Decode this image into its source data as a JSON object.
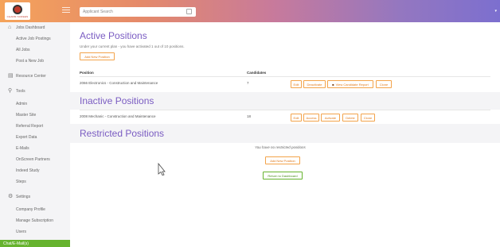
{
  "header": {
    "logo_text": "CHARM SCREEN",
    "search_placeholder": "Applicant Search"
  },
  "sidebar": {
    "items": [
      {
        "label": "Jobs Dashboard",
        "icon": "home-icon",
        "caret": true
      },
      {
        "label": "Active Job Postings"
      },
      {
        "label": "All Jobs"
      },
      {
        "label": "Post a New Job"
      },
      {
        "label": "Resource Center",
        "icon": "book-icon"
      },
      {
        "label": "Tools",
        "icon": "search-icon",
        "caret": true
      },
      {
        "label": "Admin"
      },
      {
        "label": "Master Site"
      },
      {
        "label": "Referral Report"
      },
      {
        "label": "Export Data"
      },
      {
        "label": "E-Mails"
      },
      {
        "label": "OnScreen Partners"
      },
      {
        "label": "Indeed Study"
      },
      {
        "label": "Steps"
      },
      {
        "label": "Settings",
        "icon": "gear-icon",
        "caret": true
      },
      {
        "label": "Company Profile"
      },
      {
        "label": "Manage Subscription"
      },
      {
        "label": "Users"
      }
    ],
    "active_item": "Chat/E-Mail(s)"
  },
  "active": {
    "title": "Active Positions",
    "subtitle": "Under your current plan - you have activated 1 out of 10 positions.",
    "add_button": "Add New Position",
    "col_position": "Position",
    "col_candidates": "Candidates",
    "rows": [
      {
        "position": "2066 Electronics - Construction and Maintenance",
        "candidates": "7",
        "actions": [
          "Edit",
          "Deactivate",
          "View Candidate Report",
          "Clone"
        ]
      }
    ]
  },
  "inactive": {
    "title": "Inactive Positions",
    "rows": [
      {
        "position": "2008 Mechanic - Construction and Maintenance",
        "candidates": "18",
        "actions": [
          "Edit",
          "Access",
          "Activate",
          "Delete",
          "Clone"
        ]
      }
    ]
  },
  "restricted": {
    "title": "Restricted Positions",
    "empty_note": "You have no restricted positions",
    "add_button": "Add New Position",
    "return_button": "Return to Dashboard"
  },
  "colors": {
    "accent_purple": "#7a5cc2",
    "accent_orange": "#e07a1c",
    "accent_green": "#66b32e"
  }
}
